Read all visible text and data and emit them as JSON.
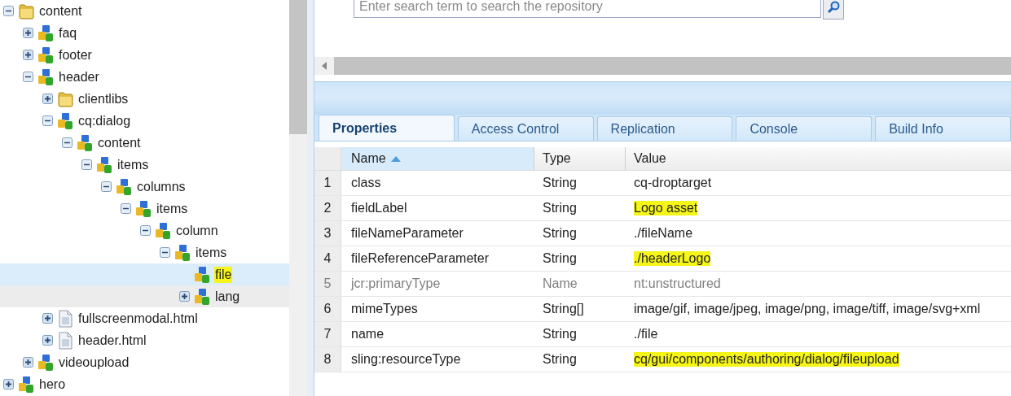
{
  "tree": {
    "nodes": [
      {
        "label": "content",
        "kind": "folder",
        "expandable": true,
        "expanded": true,
        "selected": false,
        "hovered": false,
        "highlighted": false,
        "children": [
          {
            "label": "faq",
            "kind": "node",
            "expandable": true,
            "expanded": false,
            "selected": false,
            "hovered": false,
            "highlighted": false
          },
          {
            "label": "footer",
            "kind": "node",
            "expandable": true,
            "expanded": false,
            "selected": false,
            "hovered": false,
            "highlighted": false
          },
          {
            "label": "header",
            "kind": "node",
            "expandable": true,
            "expanded": true,
            "selected": false,
            "hovered": false,
            "highlighted": false,
            "children": [
              {
                "label": "clientlibs",
                "kind": "folder",
                "expandable": true,
                "expanded": false,
                "selected": false,
                "hovered": false,
                "highlighted": false
              },
              {
                "label": "cq:dialog",
                "kind": "node",
                "expandable": true,
                "expanded": true,
                "selected": false,
                "hovered": false,
                "highlighted": false,
                "children": [
                  {
                    "label": "content",
                    "kind": "node",
                    "expandable": true,
                    "expanded": true,
                    "selected": false,
                    "hovered": false,
                    "highlighted": false,
                    "children": [
                      {
                        "label": "items",
                        "kind": "node",
                        "expandable": true,
                        "expanded": true,
                        "selected": false,
                        "hovered": false,
                        "highlighted": false,
                        "children": [
                          {
                            "label": "columns",
                            "kind": "node",
                            "expandable": true,
                            "expanded": true,
                            "selected": false,
                            "hovered": false,
                            "highlighted": false,
                            "children": [
                              {
                                "label": "items",
                                "kind": "node",
                                "expandable": true,
                                "expanded": true,
                                "selected": false,
                                "hovered": false,
                                "highlighted": false,
                                "children": [
                                  {
                                    "label": "column",
                                    "kind": "node",
                                    "expandable": true,
                                    "expanded": true,
                                    "selected": false,
                                    "hovered": false,
                                    "highlighted": false,
                                    "children": [
                                      {
                                        "label": "items",
                                        "kind": "node",
                                        "expandable": true,
                                        "expanded": true,
                                        "selected": false,
                                        "hovered": false,
                                        "highlighted": false,
                                        "children": [
                                          {
                                            "label": "file",
                                            "kind": "node",
                                            "expandable": false,
                                            "selected": true,
                                            "hovered": false,
                                            "highlighted": true
                                          },
                                          {
                                            "label": "lang",
                                            "kind": "node",
                                            "expandable": true,
                                            "expanded": false,
                                            "selected": false,
                                            "hovered": true,
                                            "highlighted": false
                                          }
                                        ]
                                      }
                                    ]
                                  }
                                ]
                              }
                            ]
                          }
                        ]
                      }
                    ]
                  }
                ]
              },
              {
                "label": "fullscreenmodal.html",
                "kind": "file",
                "expandable": true,
                "expanded": false,
                "selected": false,
                "hovered": false,
                "highlighted": false
              },
              {
                "label": "header.html",
                "kind": "file",
                "expandable": true,
                "expanded": false,
                "selected": false,
                "hovered": false,
                "highlighted": false
              }
            ]
          },
          {
            "label": "videoupload",
            "kind": "node",
            "expandable": true,
            "expanded": false,
            "selected": false,
            "hovered": false,
            "highlighted": false
          }
        ]
      },
      {
        "label": "hero",
        "kind": "node",
        "expandable": true,
        "expanded": false,
        "selected": false,
        "hovered": false,
        "highlighted": false
      }
    ]
  },
  "search": {
    "placeholder": "Enter search term to search the repository"
  },
  "tabs": [
    {
      "label": "Properties",
      "selected": true
    },
    {
      "label": "Access Control",
      "selected": false
    },
    {
      "label": "Replication",
      "selected": false
    },
    {
      "label": "Console",
      "selected": false
    },
    {
      "label": "Build Info",
      "selected": false
    }
  ],
  "table": {
    "columns": [
      {
        "label": "Name",
        "sorted": true
      },
      {
        "label": "Type",
        "sorted": false
      },
      {
        "label": "Value",
        "sorted": false
      }
    ],
    "rows": [
      {
        "index": "1",
        "name": "class",
        "type": "String",
        "value": "cq-droptarget",
        "protected": false,
        "highlighted": false
      },
      {
        "index": "2",
        "name": "fieldLabel",
        "type": "String",
        "value": "Logo asset",
        "protected": false,
        "highlighted": true
      },
      {
        "index": "3",
        "name": "fileNameParameter",
        "type": "String",
        "value": "./fileName",
        "protected": false,
        "highlighted": false
      },
      {
        "index": "4",
        "name": "fileReferenceParameter",
        "type": "String",
        "value": "./headerLogo",
        "protected": false,
        "highlighted": true
      },
      {
        "index": "5",
        "name": "jcr:primaryType",
        "type": "Name",
        "value": "nt:unstructured",
        "protected": true,
        "highlighted": false
      },
      {
        "index": "6",
        "name": "mimeTypes",
        "type": "String[]",
        "value": "image/gif, image/jpeg, image/png, image/tiff, image/svg+xml",
        "protected": false,
        "highlighted": false
      },
      {
        "index": "7",
        "name": "name",
        "type": "String",
        "value": "./file",
        "protected": false,
        "highlighted": false
      },
      {
        "index": "8",
        "name": "sling:resourceType",
        "type": "String",
        "value": "cq/gui/components/authoring/dialog/fileupload",
        "protected": false,
        "highlighted": true
      }
    ]
  }
}
